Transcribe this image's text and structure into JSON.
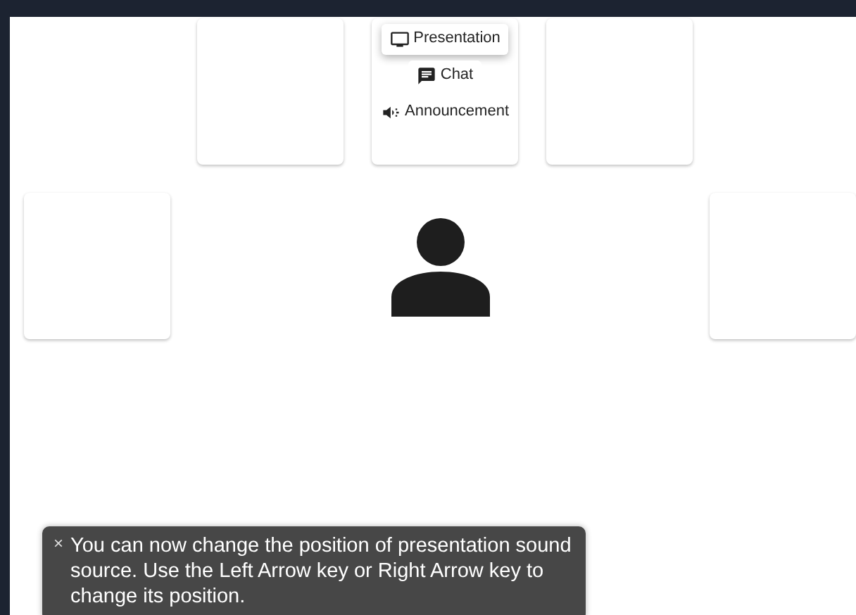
{
  "sound_source_menu": {
    "items": [
      {
        "kind": "presentation",
        "label": "Presentation",
        "selected": true
      },
      {
        "kind": "chat",
        "label": "Chat",
        "selected": false
      },
      {
        "kind": "announcement",
        "label": "Announcement",
        "selected": false
      }
    ]
  },
  "toast": {
    "close": "×",
    "message": "You can now change the position of presentation sound source. Use the Left Arrow key or Right Arrow key to change its position."
  }
}
